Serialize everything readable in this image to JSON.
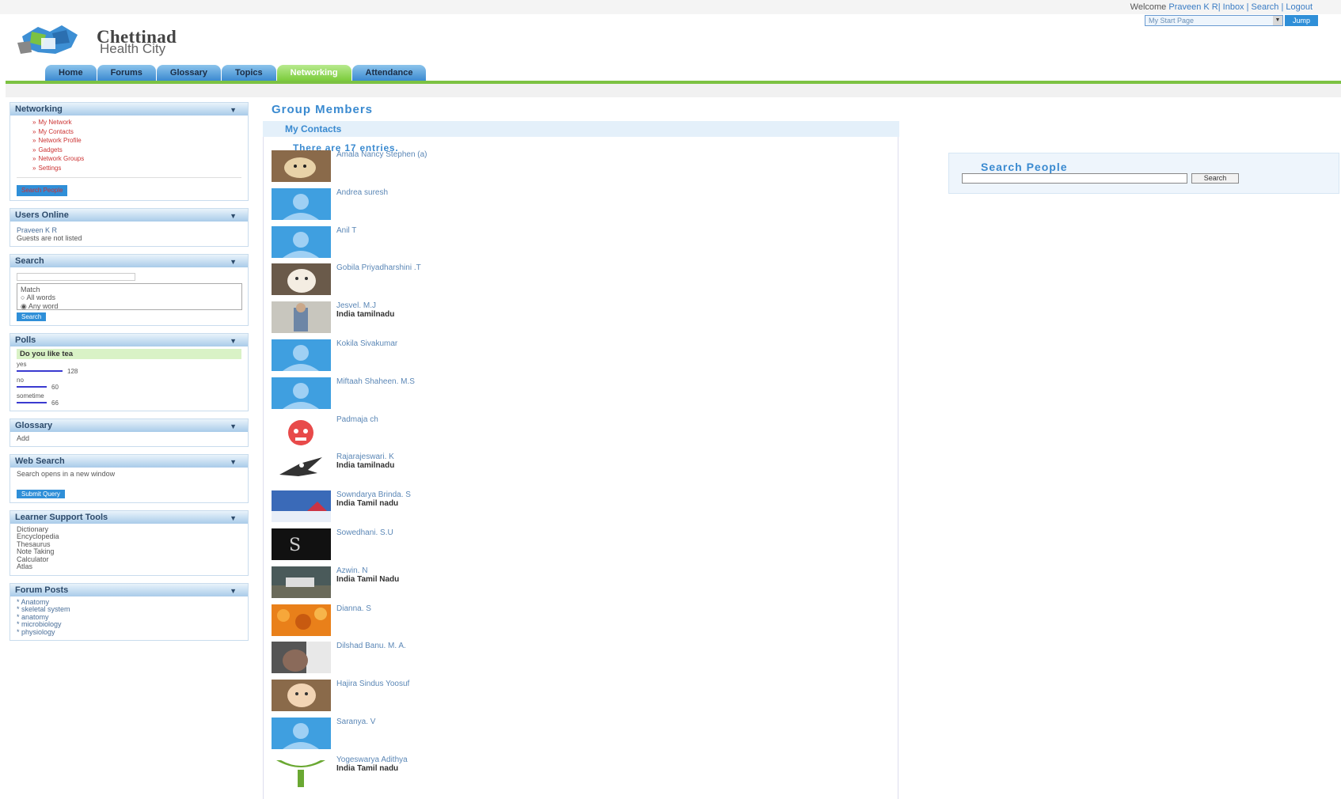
{
  "header": {
    "welcome_prefix": "Welcome",
    "user_links": "Praveen K R| Inbox | Search | Logout",
    "brand_line1": "Chettinad",
    "brand_line2": "Health City",
    "start_page_value": "My Start Page",
    "go_label": "Jump"
  },
  "nav": {
    "tabs": [
      "Home",
      "Forums",
      "Glossary",
      "Topics",
      "Networking",
      "Attendance"
    ],
    "active": "Networking"
  },
  "sidebar": {
    "networking": {
      "title": "Networking",
      "items": [
        "My Network",
        "My Contacts",
        "Network Profile",
        "Gadgets",
        "Network Groups",
        "Settings"
      ],
      "button": "Search People"
    },
    "users_online": {
      "title": "Users Online",
      "lines": [
        "Praveen K R",
        "Guests are not listed"
      ]
    },
    "search": {
      "title": "Search",
      "match_label": "Match",
      "options": [
        "All words",
        "Any word"
      ],
      "button": "Search"
    },
    "polls": {
      "title": "Polls",
      "question": "Do you like tea",
      "answers": [
        {
          "label": "yes",
          "votes": "128"
        },
        {
          "label": "no",
          "votes": "60"
        },
        {
          "label": "sometime",
          "votes": "66"
        }
      ]
    },
    "glossary": {
      "title": "Glossary",
      "text": "Add"
    },
    "web_search": {
      "title": "Web Search",
      "text": "Search opens in a new window",
      "button": "Submit Query"
    },
    "learner_tools": {
      "title": "Learner Support Tools",
      "items": [
        "Dictionary",
        "Encyclopedia",
        "Thesaurus",
        "Note Taking",
        "Calculator",
        "Atlas"
      ]
    },
    "forum_posts": {
      "title": "Forum Posts",
      "items": [
        "* Anatomy",
        "* skeletal system",
        "* anatomy",
        "* microbiology",
        "* physiology"
      ]
    }
  },
  "main": {
    "title": "Group Members",
    "section": "My Contacts",
    "count_text": "There are 17 entries.",
    "members": [
      {
        "name": "Amala Nancy Stephen (a)",
        "location": "",
        "avatar": "dog"
      },
      {
        "name": "Andrea suresh",
        "location": "",
        "avatar": "default"
      },
      {
        "name": "Anil T",
        "location": "",
        "avatar": "default"
      },
      {
        "name": "Gobila Priyadharshini .T",
        "location": "",
        "avatar": "puppy"
      },
      {
        "name": "Jesvel. M.J",
        "location": "India tamilnadu",
        "avatar": "photo"
      },
      {
        "name": "Kokila Sivakumar",
        "location": "",
        "avatar": "default"
      },
      {
        "name": "Miftaah Shaheen. M.S",
        "location": "",
        "avatar": "default"
      },
      {
        "name": "Padmaja ch",
        "location": "",
        "avatar": "cartoon"
      },
      {
        "name": "Rajarajeswari. K",
        "location": "India tamilnadu",
        "avatar": "eagle"
      },
      {
        "name": "Sowndarya Brinda. S",
        "location": "India Tamil nadu",
        "avatar": "winter"
      },
      {
        "name": "Sowedhani. S.U",
        "location": "",
        "avatar": "dark"
      },
      {
        "name": "Azwin. N",
        "location": "India Tamil Nadu",
        "avatar": "car"
      },
      {
        "name": "Dianna. S",
        "location": "",
        "avatar": "flowers"
      },
      {
        "name": "Dilshad Banu. M. A.",
        "location": "",
        "avatar": "portrait"
      },
      {
        "name": "Hajira Sindus Yoosuf",
        "location": "",
        "avatar": "baby"
      },
      {
        "name": "Saranya. V",
        "location": "",
        "avatar": "default"
      },
      {
        "name": "Yogeswarya Adithya",
        "location": "India Tamil nadu",
        "avatar": "letter"
      }
    ]
  },
  "search_people": {
    "title": "Search People",
    "button": "Search"
  },
  "colors": {
    "accent_blue": "#3a8ad0",
    "nav_green": "#7cc242",
    "default_avatar": "#3f9fe0"
  }
}
